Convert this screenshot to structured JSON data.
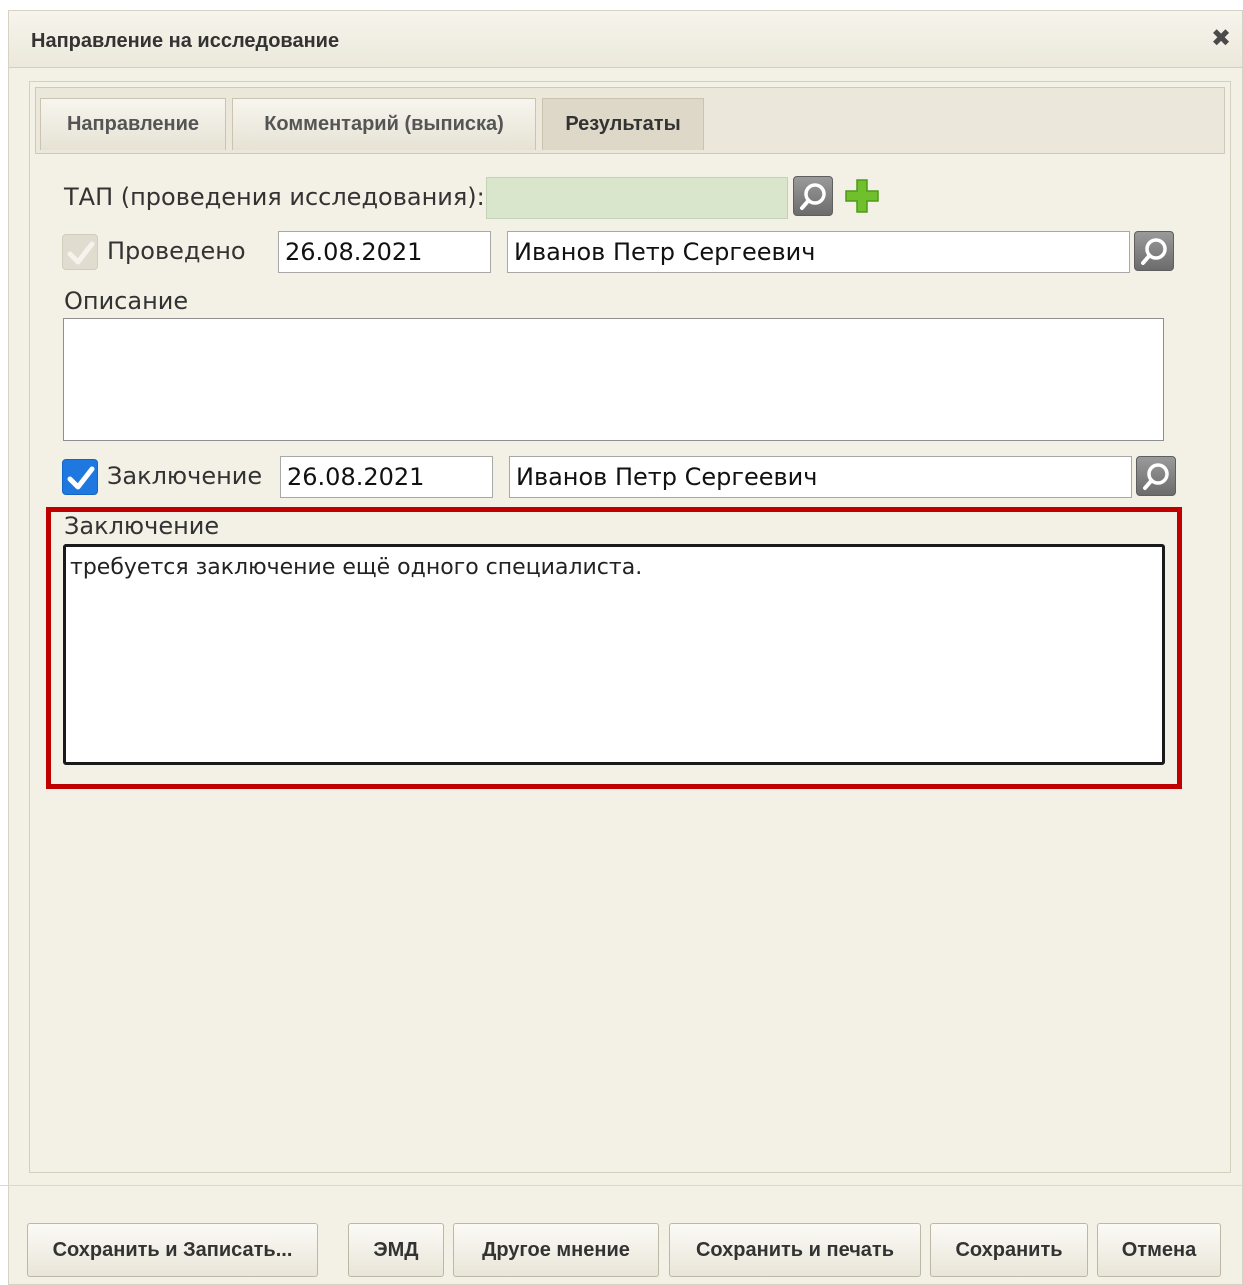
{
  "dialog": {
    "title": "Направление на исследование",
    "close_icon": "close-icon"
  },
  "tabs": [
    {
      "label": "Направление",
      "active": false
    },
    {
      "label": "Комментарий (выписка)",
      "active": false
    },
    {
      "label": "Результаты",
      "active": true
    }
  ],
  "form": {
    "tap_label": "ТАП (проведения исследования):",
    "tap_value": "",
    "performed": {
      "label": "Проведено",
      "checked": true,
      "disabled": true,
      "date": "26.08.2021",
      "doctor": "Иванов Петр Сергеевич"
    },
    "description": {
      "label": "Описание",
      "value": ""
    },
    "conclusion": {
      "label": "Заключение",
      "checked": true,
      "date": "26.08.2021",
      "doctor": "Иванов Петр Сергеевич"
    },
    "conclusion_text": {
      "label": "Заключение",
      "value": "требуется заключение ещё одного специалиста."
    }
  },
  "buttons": {
    "save_and_record": "Сохранить и Записать...",
    "emd": "ЭМД",
    "other_opinion": "Другое мнение",
    "save_and_print": "Сохранить и печать",
    "save": "Сохранить",
    "cancel": "Отмена"
  },
  "colors": {
    "checkbox_checked": "#1e78e0",
    "highlight_border": "#c00000",
    "tap_field_bg": "#d9e6cc",
    "dialog_bg": "#f3f0e5"
  }
}
